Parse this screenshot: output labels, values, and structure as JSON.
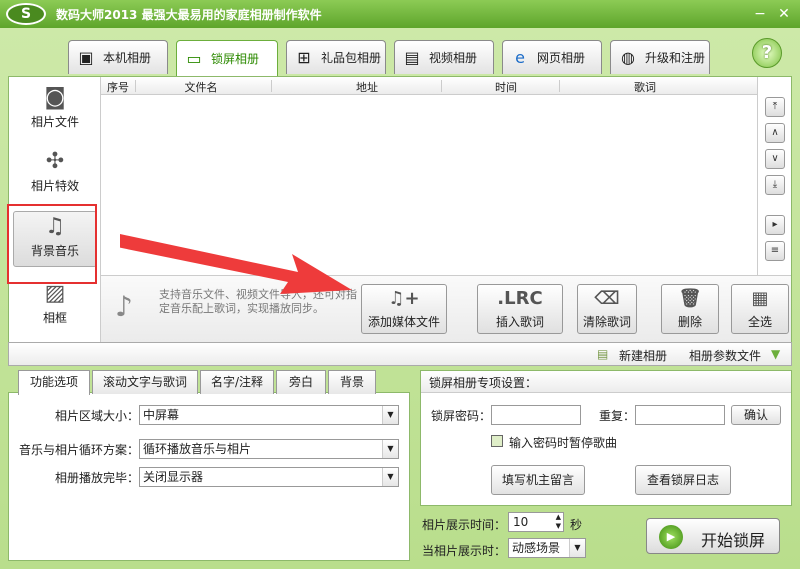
{
  "window": {
    "logo_text": "S",
    "title": "数码大师2013   最强大最易用的家庭相册制作软件",
    "min": "−",
    "close": "✕"
  },
  "tabs": [
    {
      "label": "本机相册",
      "icon": "portrait-icon"
    },
    {
      "label": "锁屏相册",
      "icon": "monitor-icon",
      "active": true
    },
    {
      "label": "礼品包相册",
      "icon": "gift-icon"
    },
    {
      "label": "视频相册",
      "icon": "film-icon"
    },
    {
      "label": "网页相册",
      "icon": "ie-icon"
    },
    {
      "label": "升级和注册",
      "icon": "globe-icon"
    }
  ],
  "help": "?",
  "leftnav": [
    {
      "label": "相片文件",
      "icon": "camera-icon"
    },
    {
      "label": "相片特效",
      "icon": "sparkle-icon"
    },
    {
      "label": "背景音乐",
      "icon": "music-note-icon",
      "active": true
    },
    {
      "label": "相框",
      "icon": "picture-frame-icon"
    }
  ],
  "list": {
    "columns": [
      "序号",
      "文件名",
      "地址",
      "时间",
      "歌词"
    ]
  },
  "toolbar": {
    "note": "支持音乐文件、视频文件导入，还可对指定音乐配上歌词，实现播放同步。",
    "buttons": [
      {
        "label": "添加媒体文件",
        "icon_text": "♫+"
      },
      {
        "label": "插入歌词",
        "icon_text": ".LRC"
      },
      {
        "label": "清除歌词",
        "icon_text": "⌫"
      },
      {
        "label": "删除",
        "icon_text": "🗑"
      },
      {
        "label": "全选",
        "icon_text": "▦"
      }
    ]
  },
  "midbar": {
    "new_album": "新建相册",
    "album_params": "相册参数文件"
  },
  "bottom_tabs": [
    "功能选项",
    "滚动文字与歌词",
    "名字/注释",
    "旁白",
    "背景"
  ],
  "options": {
    "area_size_label": "相片区域大小：",
    "area_size_value": "中屏幕",
    "loop_label": "音乐与相片循环方案：",
    "loop_value": "循环播放音乐与相片",
    "finish_label": "相册播放完毕：",
    "finish_value": "关闭显示器"
  },
  "lock": {
    "heading": "锁屏相册专项设置：",
    "password_label": "锁屏密码：",
    "repeat_label": "重复：",
    "confirm": "确认",
    "pause_music": "输入密码时暂停歌曲",
    "write_msg": "填写机主留言",
    "view_log": "查看锁屏日志"
  },
  "display": {
    "time_label": "相片展示时间：",
    "time_value": "10",
    "seconds": "秒",
    "when_label": "当相片展示时：",
    "when_value": "动感场景"
  },
  "start": "开始锁屏",
  "colors": {
    "accent": "#5ea52b",
    "highlight": "#e53030"
  }
}
